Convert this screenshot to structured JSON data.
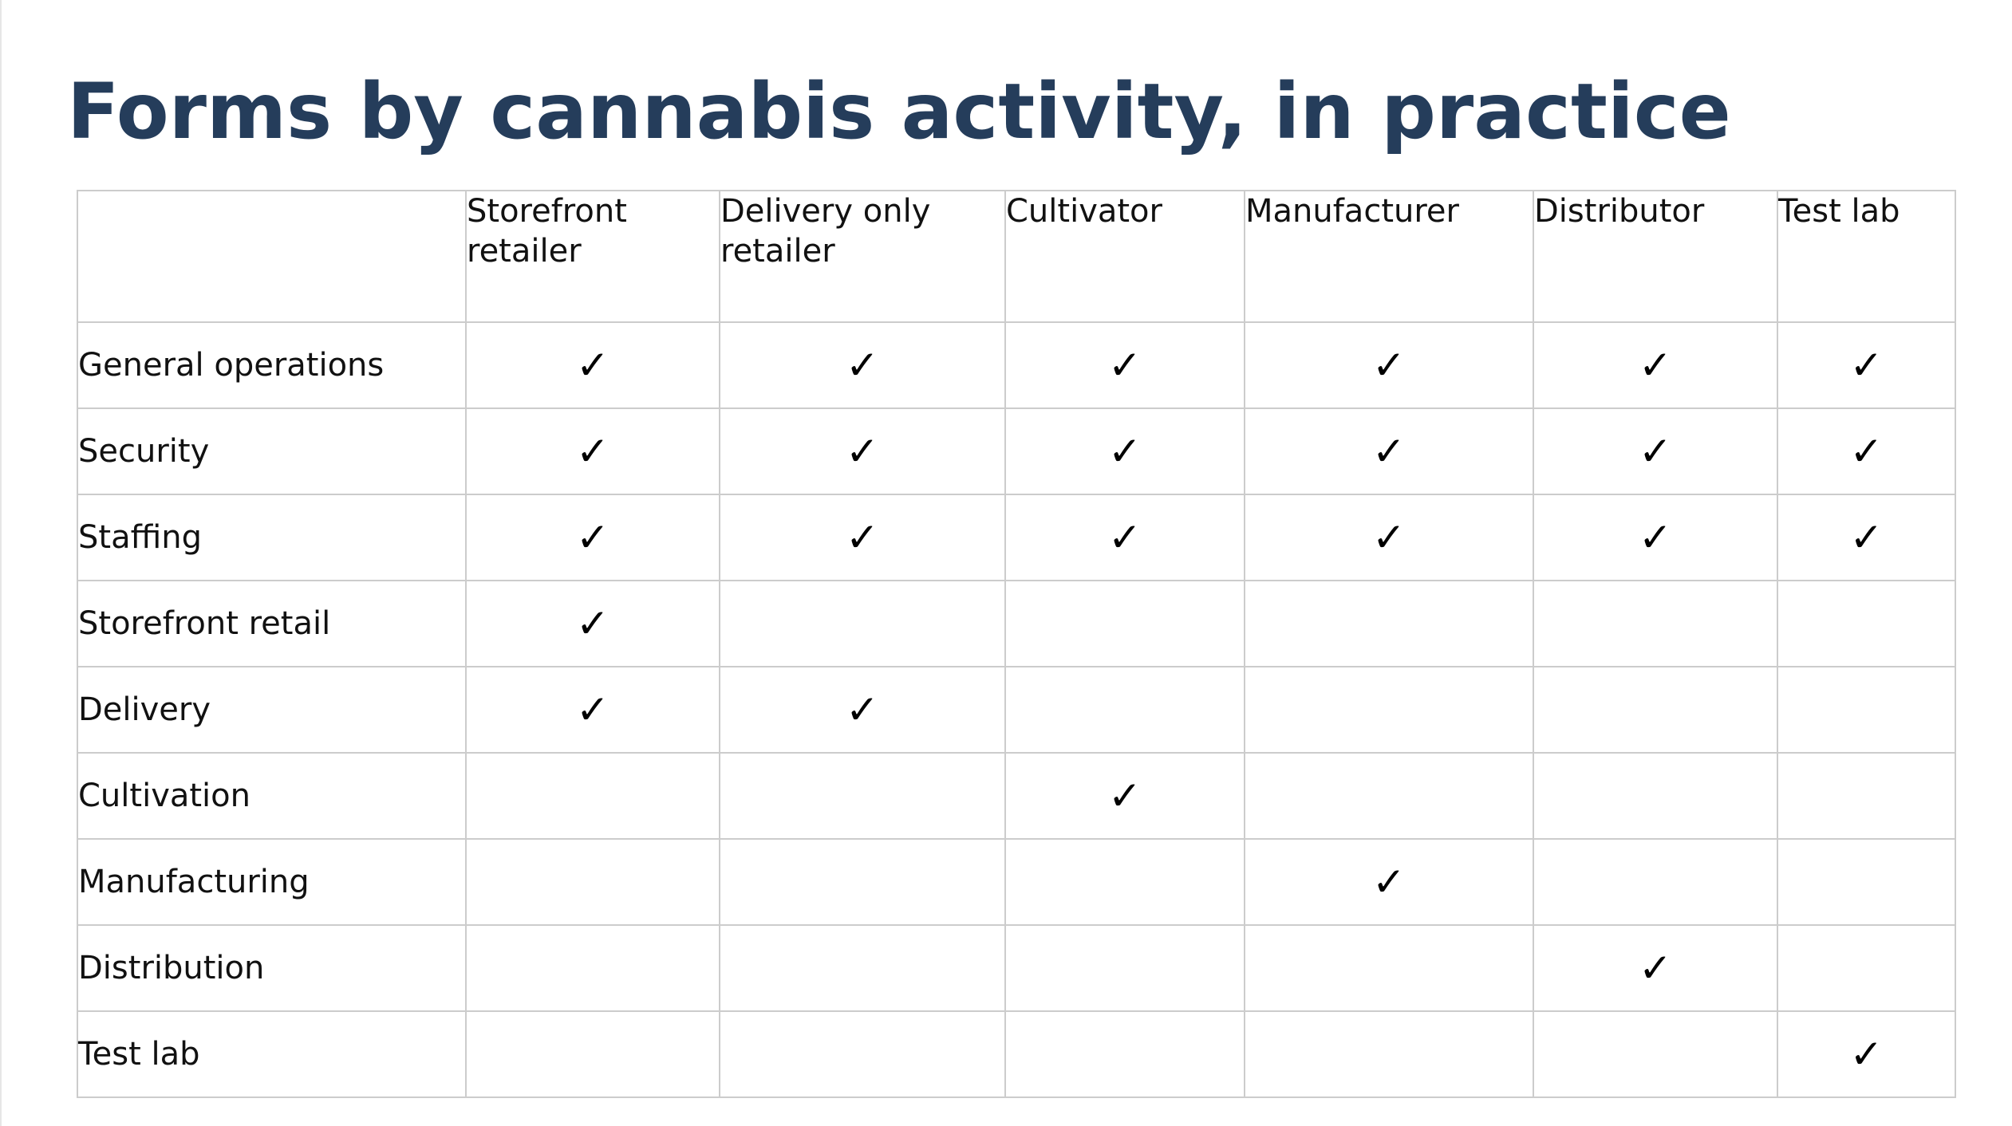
{
  "title": "Forms by cannabis activity, in practice",
  "check_glyph": "✓",
  "columns": [
    "Storefront retailer",
    "Delivery only retailer",
    "Cultivator",
    "Manufacturer",
    "Distributor",
    "Test lab"
  ],
  "rows": [
    {
      "label": "General operations",
      "checks": [
        true,
        true,
        true,
        true,
        true,
        true
      ]
    },
    {
      "label": "Security",
      "checks": [
        true,
        true,
        true,
        true,
        true,
        true
      ]
    },
    {
      "label": "Staffing",
      "checks": [
        true,
        true,
        true,
        true,
        true,
        true
      ]
    },
    {
      "label": "Storefront retail",
      "checks": [
        true,
        false,
        false,
        false,
        false,
        false
      ]
    },
    {
      "label": "Delivery",
      "checks": [
        true,
        true,
        false,
        false,
        false,
        false
      ]
    },
    {
      "label": "Cultivation",
      "checks": [
        false,
        false,
        true,
        false,
        false,
        false
      ]
    },
    {
      "label": "Manufacturing",
      "checks": [
        false,
        false,
        false,
        true,
        false,
        false
      ]
    },
    {
      "label": "Distribution",
      "checks": [
        false,
        false,
        false,
        false,
        true,
        false
      ]
    },
    {
      "label": "Test lab",
      "checks": [
        false,
        false,
        false,
        false,
        false,
        true
      ]
    }
  ],
  "colors": {
    "title": "#253d5b",
    "grid": "#cccccc",
    "text": "#111111"
  }
}
